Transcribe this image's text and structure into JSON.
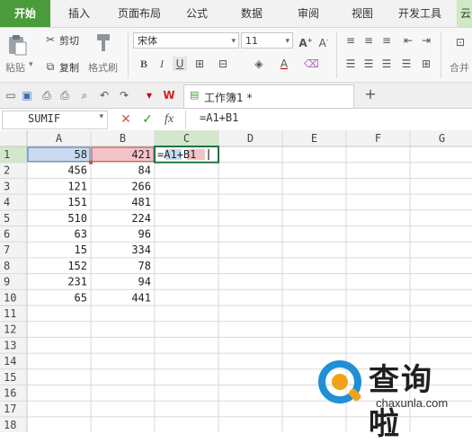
{
  "menu": {
    "tabs": [
      "开始",
      "插入",
      "页面布局",
      "公式",
      "数据",
      "审阅",
      "视图",
      "开发工具",
      "云"
    ]
  },
  "ribbon": {
    "paste_label": "粘贴",
    "cut_label": "剪切",
    "copy_label": "复制",
    "format_painter_label": "格式刷",
    "font_name": "宋体",
    "font_size": "11",
    "bold": "B",
    "italic": "I",
    "underline": "U",
    "merge_label": "合并"
  },
  "quickbar": {
    "doc_title": "工作簿1 *",
    "add_tab": "+"
  },
  "formula_bar": {
    "name_box": "SUMIF",
    "cancel": "✕",
    "confirm": "✓",
    "fx": "fx",
    "formula": "=A1+B1"
  },
  "sheet": {
    "columns": [
      "A",
      "B",
      "C",
      "D",
      "E",
      "F",
      "G"
    ],
    "rows": [
      "1",
      "2",
      "3",
      "4",
      "5",
      "6",
      "7",
      "8",
      "9",
      "10",
      "11",
      "12",
      "13",
      "14",
      "15",
      "16",
      "17",
      "18"
    ],
    "col_a": [
      58,
      456,
      121,
      151,
      510,
      63,
      15,
      152,
      231,
      65
    ],
    "col_b": [
      421,
      84,
      266,
      481,
      224,
      96,
      334,
      78,
      94,
      441
    ],
    "c1_editing": "=A1+B1"
  },
  "watermark": {
    "brand_cn": "查询啦",
    "brand_url": "chaxunla.com"
  },
  "colors": {
    "accent_green": "#4a9b3c",
    "ref_a_fill": "#c9daf0",
    "ref_a_border": "#4a7ebb",
    "ref_b_fill": "#f3c3c7",
    "ref_b_border": "#c0504d",
    "active_border": "#217346"
  }
}
